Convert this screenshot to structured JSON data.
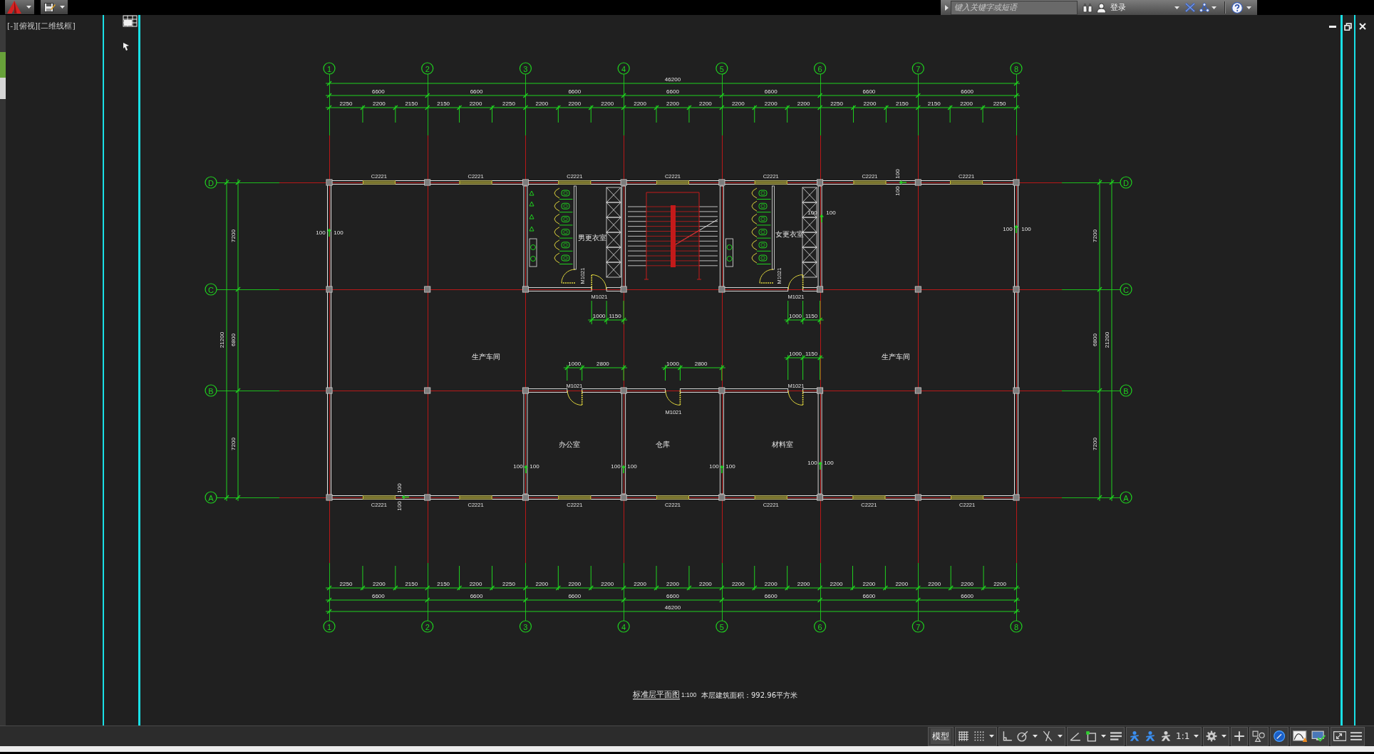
{
  "title_bar": {
    "search": {
      "placeholder": "键入关键字或短语"
    },
    "sign_in": "登录"
  },
  "viewport": {
    "label": "[-][俯视][二维线框]"
  },
  "drawing": {
    "top_axis_labels": [
      "1",
      "2",
      "3",
      "4",
      "5",
      "6",
      "7",
      "8"
    ],
    "bottom_axis_labels": [
      "1",
      "2",
      "3",
      "4",
      "5",
      "6",
      "7",
      "8"
    ],
    "left_axis_labels": [
      "D",
      "C",
      "B",
      "A"
    ],
    "right_axis_labels": [
      "D",
      "C",
      "B",
      "A"
    ],
    "top_dimensions": {
      "total": "46200",
      "bays": [
        "6600",
        "6600",
        "6600",
        "6600",
        "6600",
        "6600",
        "6600"
      ],
      "segments": [
        "2250",
        "2200",
        "2150",
        "2150",
        "2200",
        "2250",
        "2200",
        "2200",
        "2200",
        "2200",
        "2200",
        "2200",
        "2200",
        "2200",
        "2200",
        "2250",
        "2200",
        "2150",
        "2150",
        "2200",
        "2250"
      ]
    },
    "bottom_dimensions": {
      "total": "46200",
      "bays": [
        "6600",
        "6600",
        "6600",
        "6600",
        "6600",
        "6600",
        "6600"
      ],
      "segments": [
        "2250",
        "2200",
        "2150",
        "2150",
        "2200",
        "2250",
        "2200",
        "2200",
        "2200",
        "2200",
        "2200",
        "2200",
        "2200",
        "2200",
        "2200",
        "2200",
        "2200",
        "2200",
        "2200",
        "2200",
        "2200"
      ]
    },
    "left_dimensions": {
      "total": "21200",
      "bays": [
        "7200",
        "6800",
        "7200"
      ]
    },
    "right_dimensions": {
      "total": "21200",
      "bays": [
        "7200",
        "6800",
        "7200"
      ]
    },
    "top_windows": [
      "C2221",
      "C2221",
      "C2221",
      "C2221",
      "C2221",
      "C2221",
      "C2221"
    ],
    "bottom_windows": [
      "C2221",
      "C2221",
      "C2221",
      "C2221",
      "C2221",
      "C2221",
      "C2221"
    ],
    "rooms": [
      "男更衣室",
      "女更衣室",
      "生产车间",
      "生产车间",
      "办公室",
      "仓库",
      "材料室"
    ],
    "doors": [
      "M1021",
      "M1021",
      "M1021",
      "M1021",
      "M1021",
      "M1021",
      "M1021"
    ],
    "door_dimensions": [
      [
        "1000",
        "1150"
      ],
      [
        "1000",
        "1150"
      ],
      [
        "1000",
        "2800"
      ],
      [
        "1000",
        "2800"
      ],
      [
        "1000",
        "1150"
      ]
    ],
    "offset_notes": [
      [
        "100",
        "100"
      ],
      [
        "100",
        "100"
      ],
      [
        "100",
        "100"
      ],
      [
        "100",
        "100"
      ],
      [
        "100",
        "100"
      ],
      [
        "100",
        "100"
      ],
      [
        "100",
        "100"
      ],
      [
        "100",
        "100"
      ],
      [
        "100",
        "100"
      ]
    ],
    "caption": {
      "title": "标准层平面图",
      "scale": "1:100",
      "area": "本层建筑面积：992.96平方米"
    }
  },
  "status_bar": {
    "tool_groups": [
      [
        {
          "kind": "model",
          "label": "模型"
        }
      ],
      [
        {
          "kind": "grid",
          "on": false
        },
        {
          "kind": "snap",
          "on": false,
          "menu": true
        }
      ],
      [
        {
          "kind": "ortho",
          "on": false
        },
        {
          "kind": "polar",
          "on": false,
          "menu": true
        },
        {
          "kind": "isodraft",
          "on": false,
          "menu": true
        }
      ],
      [
        {
          "kind": "tracking",
          "on": false
        },
        {
          "kind": "osnap",
          "on": false,
          "menu": true
        },
        {
          "kind": "lineweight",
          "on": false
        }
      ],
      [
        {
          "kind": "annotation_visibility",
          "on": true
        },
        {
          "kind": "auto_scale",
          "on": true
        },
        {
          "kind": "annotation_monitor",
          "on": false
        },
        {
          "kind": "scale",
          "label": "1:1",
          "menu": true
        }
      ],
      [
        {
          "kind": "workspace",
          "menu": true
        }
      ],
      [
        {
          "kind": "units"
        }
      ],
      [
        {
          "kind": "isolate"
        }
      ],
      [
        {
          "kind": "hardware",
          "on": true
        }
      ],
      [
        {
          "kind": "clean_screen_warning"
        },
        {
          "kind": "monitor"
        }
      ],
      [
        {
          "kind": "fullscreen"
        },
        {
          "kind": "customize"
        }
      ]
    ]
  }
}
